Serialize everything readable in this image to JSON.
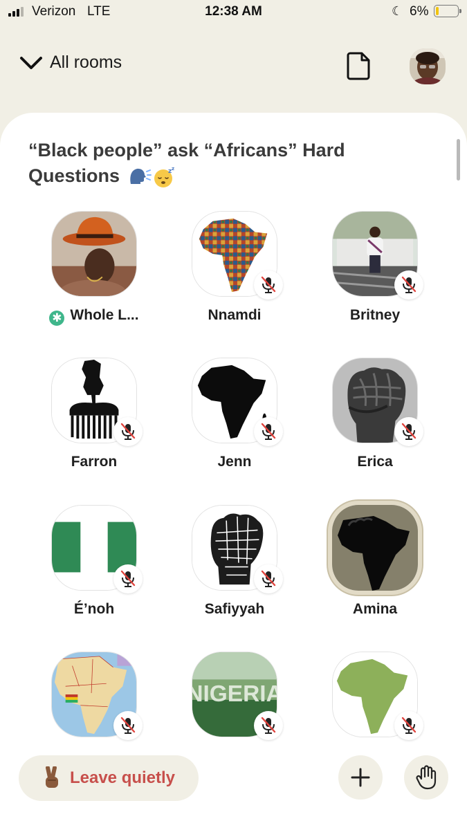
{
  "status_bar": {
    "carrier": "Verizon",
    "network": "LTE",
    "time": "12:38 AM",
    "battery_percent": "6%"
  },
  "header": {
    "rooms_label": "All rooms"
  },
  "room": {
    "title": "“Black people” ask “Africans” Hard Questions",
    "title_emojis": [
      "speaking-head",
      "sleeping-face"
    ],
    "speakers": [
      {
        "name": "Whole L...",
        "avatar": "photo-man-orange-hat",
        "muted": false,
        "moderator": true
      },
      {
        "name": "Nnamdi",
        "avatar": "africa-map-pattern",
        "muted": true
      },
      {
        "name": "Britney",
        "avatar": "photo-woman-patio",
        "muted": true
      },
      {
        "name": "Farron",
        "avatar": "afro-pick-fist",
        "muted": true
      },
      {
        "name": "Jenn",
        "avatar": "africa-map-black",
        "muted": true
      },
      {
        "name": "Erica",
        "avatar": "raised-fist-photo",
        "muted": true
      },
      {
        "name": "É’noh",
        "avatar": "nigeria-flag",
        "muted": true
      },
      {
        "name": "Safiyyah",
        "avatar": "fist-word-art",
        "muted": true
      },
      {
        "name": "Amina",
        "avatar": "fist-africa-olive",
        "muted": false,
        "framed": true
      },
      {
        "name": "",
        "avatar": "africa-political-map",
        "muted": true
      },
      {
        "name": "",
        "avatar": "nigeria-text-landscape",
        "muted": true
      },
      {
        "name": "",
        "avatar": "africa-map-green",
        "muted": true
      }
    ]
  },
  "bottom_bar": {
    "leave_label": "Leave quietly",
    "leave_emoji": "victory-hand"
  },
  "colors": {
    "background": "#f1efe5",
    "card": "#ffffff",
    "leave_text": "#c74f4b",
    "moderator_badge": "#3fb68b",
    "mute_slash": "#e0443e"
  }
}
